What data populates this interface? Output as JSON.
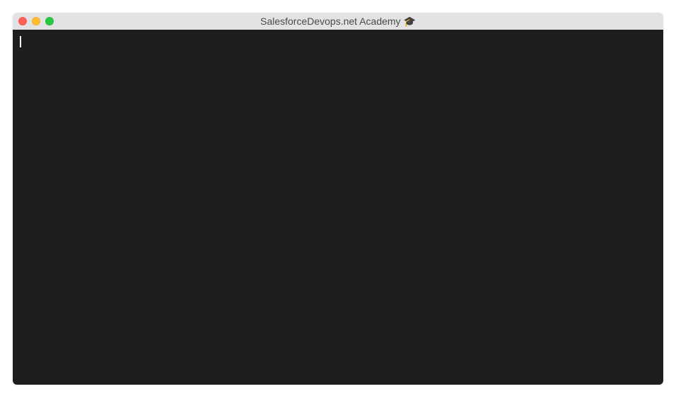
{
  "window": {
    "title": "SalesforceDevops.net Academy 🎓"
  },
  "terminal": {
    "content": ""
  }
}
